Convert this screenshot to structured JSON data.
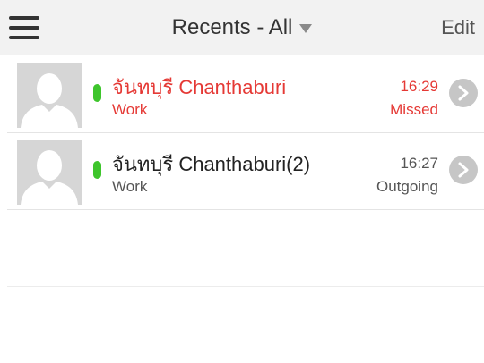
{
  "header": {
    "title": "Recents - All",
    "edit_label": "Edit"
  },
  "recents": [
    {
      "name": "จันทบุรี Chanthaburi",
      "type": "Work",
      "time": "16:29",
      "status": "Missed"
    },
    {
      "name": "จันทบุรี Chanthaburi(2)",
      "type": "Work",
      "time": "16:27",
      "status": "Outgoing"
    }
  ],
  "colors": {
    "missed": "#e53935",
    "presence_available": "#3ec52c",
    "header_bg": "#f2f2f2"
  },
  "icons": {
    "menu": "hamburger-menu-icon",
    "filter": "caret-down-icon",
    "avatar": "default-avatar-icon",
    "detail": "chevron-right-icon"
  }
}
